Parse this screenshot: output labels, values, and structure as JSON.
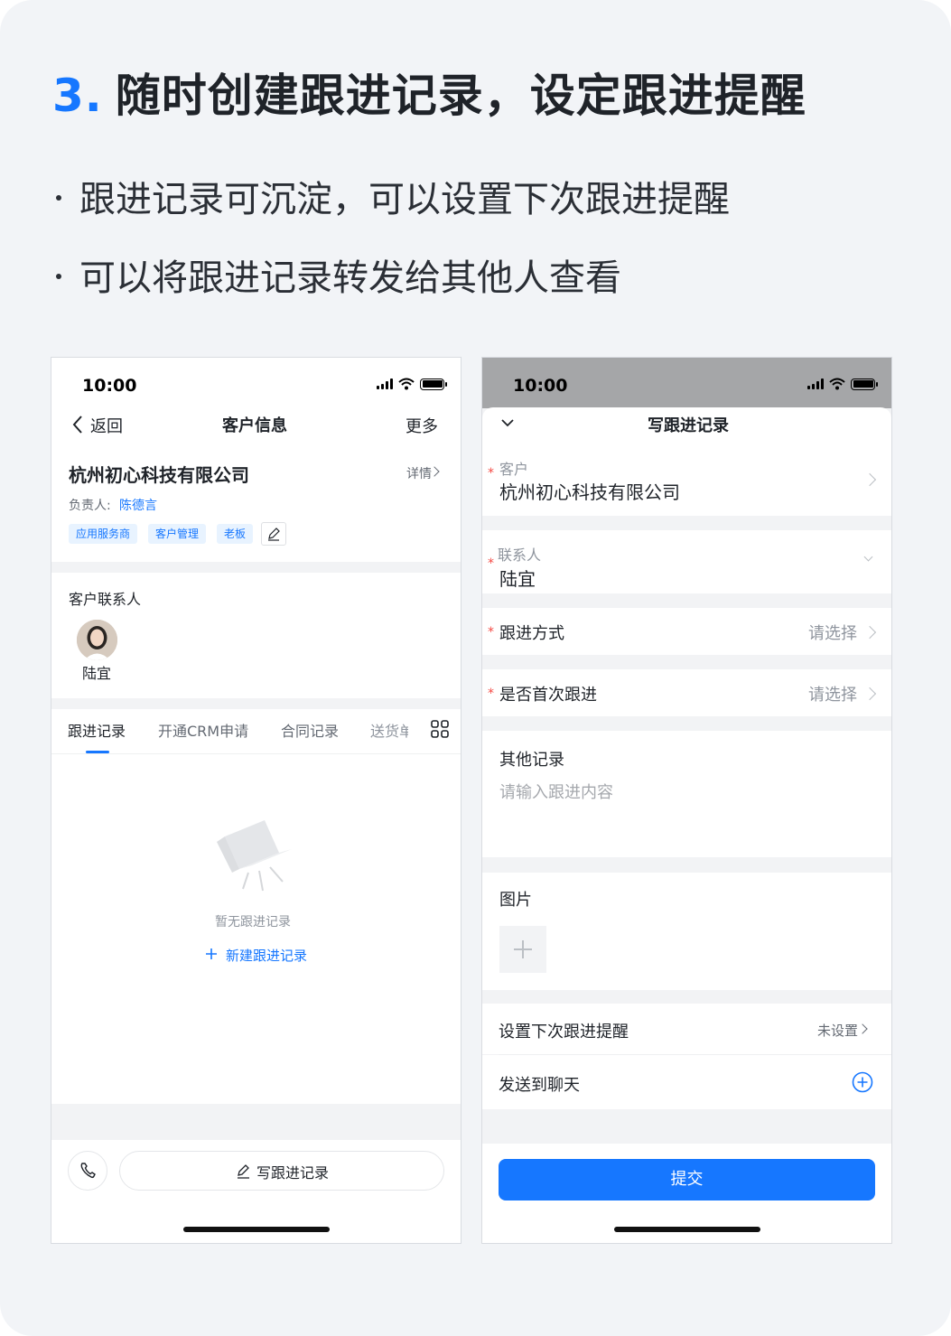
{
  "heading": {
    "number": "3.",
    "title": "随时创建跟进记录，设定跟进提醒"
  },
  "bullets": [
    "跟进记录可沉淀，可以设置下次跟进提醒",
    "可以将跟进记录转发给其他人查看"
  ],
  "left_phone": {
    "status_time": "10:00",
    "nav": {
      "back": "返回",
      "title": "客户信息",
      "more": "更多"
    },
    "company": {
      "name": "杭州初心科技有限公司",
      "detail_link": "详情",
      "owner_label": "负责人:",
      "owner_name": "陈德言"
    },
    "tags": [
      "应用服务商",
      "客户管理",
      "老板"
    ],
    "contacts_title": "客户联系人",
    "contact_name": "陆宜",
    "tabs": [
      "跟进记录",
      "开通CRM申请",
      "合同记录",
      "送货单"
    ],
    "active_tab": "跟进记录",
    "empty_text": "暂无跟进记录",
    "new_record": "新建跟进记录",
    "write_record_button": "写跟进记录"
  },
  "right_phone": {
    "status_time": "10:00",
    "title": "写跟进记录",
    "fields": {
      "customer_label": "客户",
      "customer_value": "杭州初心科技有限公司",
      "contact_label": "联系人",
      "contact_value": "陆宜",
      "method_label": "跟进方式",
      "method_placeholder": "请选择",
      "first_label": "是否首次跟进",
      "first_placeholder": "请选择",
      "other_label": "其他记录",
      "other_placeholder": "请输入跟进内容",
      "image_label": "图片",
      "reminder_label": "设置下次跟进提醒",
      "reminder_value": "未设置",
      "send_label": "发送到聊天"
    },
    "required_mark": "*",
    "submit": "提交"
  },
  "colors": {
    "accent": "#1677ff",
    "card_bg": "#f2f4f7",
    "required": "#f54a45"
  }
}
